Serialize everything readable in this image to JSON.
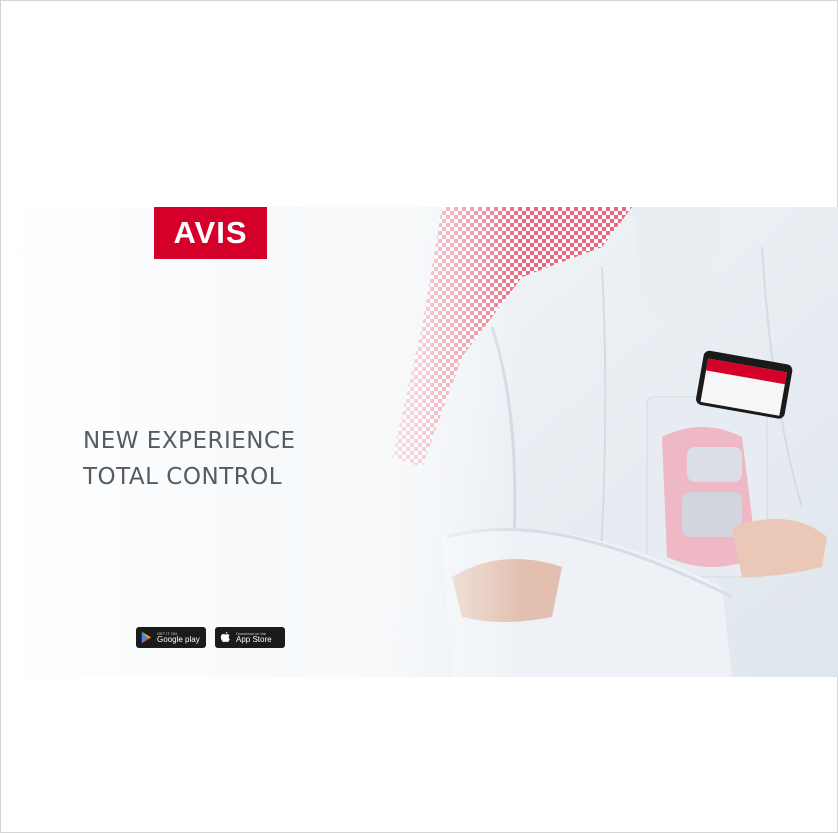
{
  "brand": {
    "logo_text": "AVIS",
    "logo_color": "#d4002a"
  },
  "hero": {
    "headline_line1": "NEW EXPERIENCE",
    "headline_line2": "TOTAL CONTROL",
    "text_color": "#555b61"
  },
  "app_badges": {
    "google_play": {
      "icon": "google-play-icon",
      "small_text": "GET IT ON",
      "label": "Google play"
    },
    "app_store": {
      "icon": "apple-icon",
      "small_text": "Download on the",
      "label": "App Store"
    }
  },
  "colors": {
    "page_background": "#ffffff",
    "banner_background": "#eef2f6",
    "badge_background": "#1b1b1b"
  }
}
